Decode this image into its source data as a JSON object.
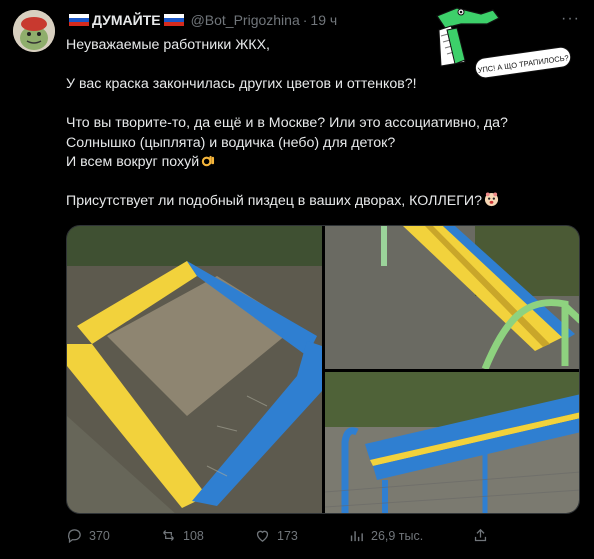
{
  "author": {
    "name": "ДУМАЙТЕ",
    "handle": "@Bot_Prigozhina",
    "time": "19 ч"
  },
  "sticker_text": "УПС! А ЩО ТРАПИЛОСЬ?",
  "post_lines": [
    "Неуважаемые работники ЖКХ,",
    "",
    "У вас краска закончилась других цветов и оттенков?!",
    "",
    "Что вы творите-то, да ещё и в Москве? Или это ассоциативно, да?",
    "Солнышко (цыплята) и водичка (небо) для деток?",
    "И всем вокруг похуй",
    "",
    "Присутствует ли подобный пиздец в ваших дворах, КОЛЛЕГИ?"
  ],
  "media": [
    {
      "alt": "sandbox-yellow-blue"
    },
    {
      "alt": "bench-yellow-blue"
    },
    {
      "alt": "bench-blue-yellow"
    }
  ],
  "stats": {
    "replies": "370",
    "reposts": "108",
    "likes": "173",
    "views": "26,9 тыс."
  },
  "colors": {
    "background": "#000000",
    "text": "#e7e9ea",
    "muted": "#71767b",
    "yellow": "#f2d23c",
    "blue": "#2f7fd1",
    "sticker_green": "#3dd06a"
  }
}
